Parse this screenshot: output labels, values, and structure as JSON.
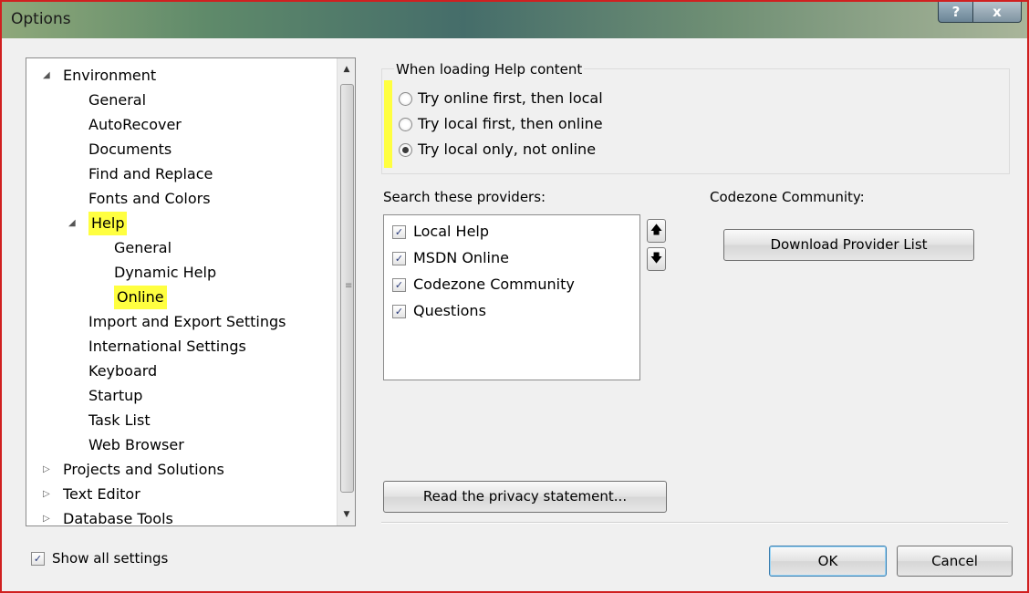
{
  "window": {
    "title": "Options",
    "help_label": "?",
    "close_label": "x"
  },
  "tree": {
    "items": [
      {
        "label": "Environment",
        "level": 0,
        "expander": "◢"
      },
      {
        "label": "General",
        "level": 1
      },
      {
        "label": "AutoRecover",
        "level": 1
      },
      {
        "label": "Documents",
        "level": 1
      },
      {
        "label": "Find and Replace",
        "level": 1
      },
      {
        "label": "Fonts and Colors",
        "level": 1
      },
      {
        "label": "Help",
        "level": 1,
        "expander": "◢",
        "highlighted": true
      },
      {
        "label": "General",
        "level": 2
      },
      {
        "label": "Dynamic Help",
        "level": 2
      },
      {
        "label": "Online",
        "level": 2,
        "highlighted": true,
        "selected": true
      },
      {
        "label": "Import and Export Settings",
        "level": 1
      },
      {
        "label": "International Settings",
        "level": 1
      },
      {
        "label": "Keyboard",
        "level": 1
      },
      {
        "label": "Startup",
        "level": 1
      },
      {
        "label": "Task List",
        "level": 1
      },
      {
        "label": "Web Browser",
        "level": 1
      },
      {
        "label": "Projects and Solutions",
        "level": 0,
        "expander": "▷"
      },
      {
        "label": "Text Editor",
        "level": 0,
        "expander": "▷"
      },
      {
        "label": "Database Tools",
        "level": 0,
        "expander": "▷"
      }
    ]
  },
  "help_content": {
    "legend": "When loading Help content",
    "options": [
      {
        "label": "Try online first, then local",
        "checked": false
      },
      {
        "label": "Try local first, then online",
        "checked": false
      },
      {
        "label": "Try local only, not online",
        "checked": true
      }
    ]
  },
  "providers": {
    "label": "Search these providers:",
    "items": [
      {
        "label": "Local Help",
        "checked": true
      },
      {
        "label": "MSDN Online",
        "checked": true
      },
      {
        "label": "Codezone Community",
        "checked": true
      },
      {
        "label": "Questions",
        "checked": true
      }
    ],
    "up_label": "🡅",
    "down_label": "🡇"
  },
  "codezone": {
    "label": "Codezone Community:",
    "download_button": "Download Provider List"
  },
  "privacy_button": "Read the privacy statement...",
  "show_all": {
    "label": "Show all settings",
    "checked": true
  },
  "footer": {
    "ok_label": "OK",
    "cancel_label": "Cancel"
  },
  "colors": {
    "highlight": "#ffff40",
    "frame_border": "#d02020"
  }
}
